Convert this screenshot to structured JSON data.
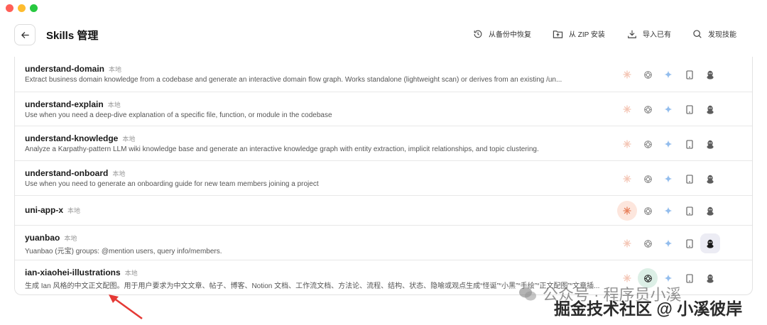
{
  "window": {
    "controls": [
      "close",
      "minimize",
      "maximize"
    ]
  },
  "header": {
    "title": "Skills 管理",
    "back_icon": "arrow-left-icon",
    "actions": [
      {
        "id": "restore",
        "label": "从备份中恢复",
        "icon": "history-icon"
      },
      {
        "id": "zip",
        "label": "从 ZIP 安装",
        "icon": "folder-upload-icon"
      },
      {
        "id": "import",
        "label": "导入已有",
        "icon": "download-icon"
      },
      {
        "id": "discover",
        "label": "发现技能",
        "icon": "search-icon"
      }
    ]
  },
  "skills": [
    {
      "name": "understand-domain",
      "tag": "本地",
      "description": "Extract business domain knowledge from a codebase and generate an interactive domain flow graph. Works standalone (lightweight scan) or derives from an existing /un...",
      "active": []
    },
    {
      "name": "understand-explain",
      "tag": "本地",
      "description": "Use when you need a deep-dive explanation of a specific file, function, or module in the codebase",
      "active": []
    },
    {
      "name": "understand-knowledge",
      "tag": "本地",
      "description": "Analyze a Karpathy-pattern LLM wiki knowledge base and generate an interactive knowledge graph with entity extraction, implicit relationships, and topic clustering.",
      "active": []
    },
    {
      "name": "understand-onboard",
      "tag": "本地",
      "description": "Use when you need to generate an onboarding guide for new team members joining a project",
      "active": []
    },
    {
      "name": "uni-app-x",
      "tag": "本地",
      "description": "",
      "active": [
        "claude"
      ]
    },
    {
      "name": "yuanbao",
      "tag": "本地",
      "description": "Yuanbao (元宝) groups: @mention users, query info/members.",
      "active": [
        "qq"
      ]
    },
    {
      "name": "ian-xiaohei-illustrations",
      "tag": "本地",
      "description": "生成 Ian 风格的中文正文配图。用于用户要求为中文文章、帖子、博客、Notion 文档、工作流文档、方法论、流程、结构、状态、隐喻或观点生成“怪诞”“小黑”“手绘”“正文配图”“文章插...",
      "active": [
        "openai"
      ]
    }
  ],
  "app_icons": [
    "claude-icon",
    "openai-icon",
    "gemini-sparkle-icon",
    "device-icon",
    "qq-penguin-icon"
  ],
  "colors": {
    "claude": "#e8825e",
    "openai": "#222222",
    "gemini": "#6fa8e8",
    "qq": "#1a1a1a",
    "arrow": "#e53935"
  },
  "watermark": {
    "line1": "公众号 · 程序员小溪",
    "line2": "掘金技术社区 @ 小溪彼岸"
  }
}
